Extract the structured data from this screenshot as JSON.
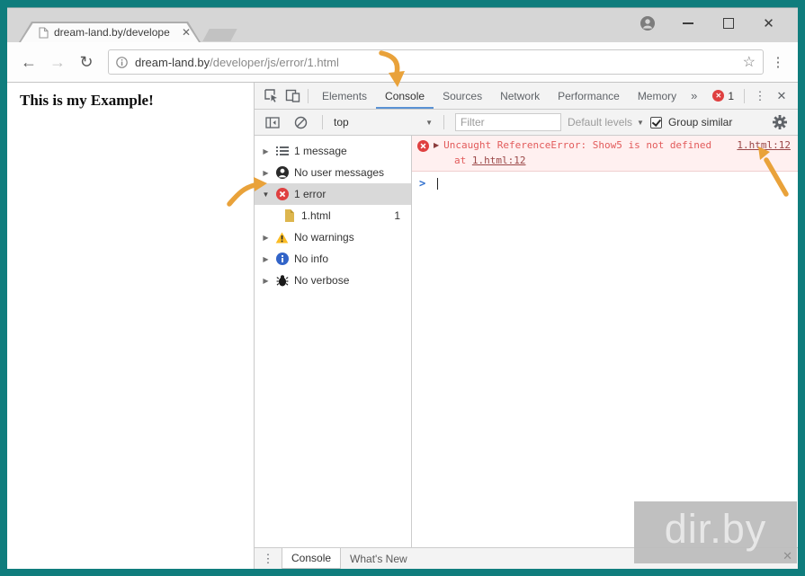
{
  "glyphs": {
    "close": "✕",
    "star": "☆",
    "dots_v": "⋮",
    "more": "»",
    "dropdown": "▼",
    "tri_right": "▶",
    "tri_down": "▼",
    "prompt": ">",
    "back": "←",
    "forward": "→",
    "refresh": "↻"
  },
  "browser": {
    "tab_title": "dream-land.by/develope",
    "url_host": "dream-land.by",
    "url_path": "/developer/js/error/1.html"
  },
  "page": {
    "heading": "This is my Example!"
  },
  "devtools": {
    "tabs": [
      "Elements",
      "Console",
      "Sources",
      "Network",
      "Performance",
      "Memory"
    ],
    "active_tab": "Console",
    "badge_count": "1",
    "toolbar": {
      "context": "top",
      "filter_placeholder": "Filter",
      "levels": "Default levels",
      "group": "Group similar"
    },
    "sidebar": [
      {
        "label": "1 message"
      },
      {
        "label": "No user messages"
      },
      {
        "label": "1 error"
      },
      {
        "label": "1.html",
        "count": "1"
      },
      {
        "label": "No warnings"
      },
      {
        "label": "No info"
      },
      {
        "label": "No verbose"
      }
    ],
    "console": {
      "error_message": "Uncaught ReferenceError: Show5 is not defined",
      "error_location": "1.html:12",
      "stack_prefix": "at",
      "stack_location": "1.html:12"
    },
    "drawer": {
      "tab_console": "Console",
      "tab_whats_new": "What's New"
    }
  },
  "watermark": {
    "text": "dir.by",
    "close": "✕"
  },
  "colors": {
    "window_frame_teal": "#0f7d7d",
    "error_red": "#df4040",
    "error_row_bg": "#fff0f0",
    "arrow_orange": "#e9a23a",
    "active_tab_underline": "#5a92d4",
    "warning_yellow": "#fbbc23",
    "info_blue": "#3264c8",
    "file_icon_tan": "#ddb64e"
  }
}
